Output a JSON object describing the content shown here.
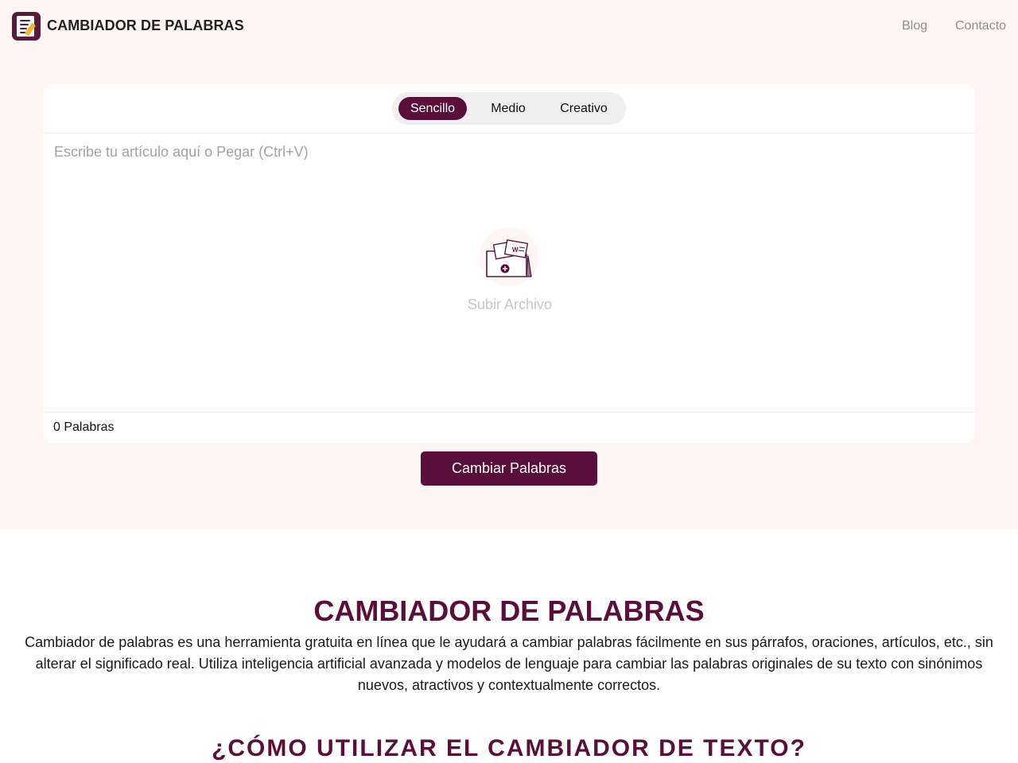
{
  "header": {
    "brand": "CAMBIADOR DE PALABRAS",
    "nav": [
      "Blog",
      "Contacto"
    ]
  },
  "editor": {
    "modes": [
      "Sencillo",
      "Medio",
      "Creativo"
    ],
    "active_mode": "Sencillo",
    "placeholder": "Escribe tu artículo aquí o Pegar (Ctrl+V)",
    "value": "",
    "upload_label": "Subir Archivo",
    "word_count": "0 Palabras"
  },
  "cta": {
    "label": "Cambiar Palabras"
  },
  "intro": {
    "title": "CAMBIADOR DE PALABRAS",
    "text": "Cambiador de palabras es una herramienta gratuita en línea que le ayudará a cambiar palabras fácilmente en sus párrafos, oraciones, artículos, etc., sin alterar el significado real. Utiliza inteligencia artificial avanzada y modelos de lenguaje para cambiar las palabras originales de su texto con sinónimos nuevos, atractivos y contextualmente correctos."
  },
  "howto": {
    "title": "¿CÓMO UTILIZAR EL CAMBIADOR DE TEXTO?"
  },
  "icons": {
    "logo": "notepad-pencil-icon",
    "upload": "folder-documents-plus-icon"
  },
  "colors": {
    "brand": "#5a0f3a",
    "hero_background": "#fff5f4",
    "muted_text": "#8f8f8f",
    "accent_pencil": "#f3b52f"
  }
}
